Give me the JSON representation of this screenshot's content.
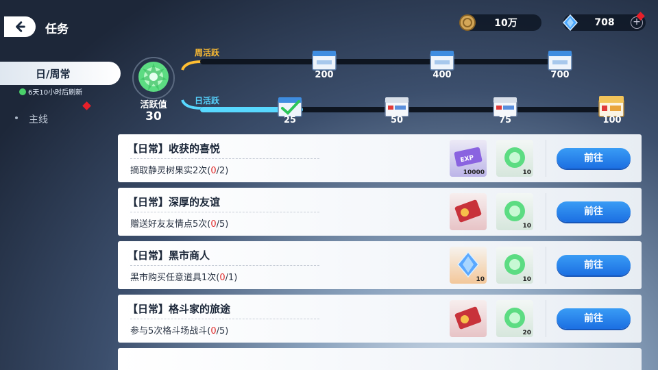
{
  "header": {
    "title": "任务",
    "currency_gold": "10万",
    "currency_gem": "708",
    "plus_symbol": "+"
  },
  "sidebar": {
    "tab_daily": "日/周常",
    "refresh_note": "6天10小时后刷新",
    "tab_main": "主线"
  },
  "activity": {
    "label": "活跃值",
    "value": "30",
    "weekly_label": "周活跃",
    "daily_label": "日活跃",
    "weekly_progress": 0,
    "daily_progress": 0.25,
    "weekly_milestones": [
      "200",
      "400",
      "700"
    ],
    "daily_milestones": [
      "25",
      "50",
      "75",
      "100"
    ]
  },
  "tasks": [
    {
      "title": "【日常】收获的喜悦",
      "desc_prefix": "摘取静灵树果实2次(",
      "current": "0",
      "desc_suffix": "/2)",
      "reward1_icon": "exp-ticket-icon",
      "reward1_count": "10000",
      "reward2_icon": "activity-orb-icon",
      "reward2_count": "10",
      "button": "前往"
    },
    {
      "title": "【日常】深厚的友谊",
      "desc_prefix": "赠送好友友情点5次(",
      "current": "0",
      "desc_suffix": "/5)",
      "reward1_icon": "friendship-ticket-icon",
      "reward1_count": "",
      "reward2_icon": "activity-orb-icon",
      "reward2_count": "10",
      "button": "前往"
    },
    {
      "title": "【日常】黑市商人",
      "desc_prefix": "黑市购买任意道具1次(",
      "current": "0",
      "desc_suffix": "/1)",
      "reward1_icon": "blue-crystal-icon",
      "reward1_count": "10",
      "reward2_icon": "activity-orb-icon",
      "reward2_count": "10",
      "button": "前往"
    },
    {
      "title": "【日常】格斗家的旅途",
      "desc_prefix": "参与5次格斗场战斗(",
      "current": "0",
      "desc_suffix": "/5)",
      "reward1_icon": "friendship-ticket-icon",
      "reward1_count": "",
      "reward2_icon": "activity-orb-icon",
      "reward2_count": "20",
      "button": "前往"
    }
  ]
}
